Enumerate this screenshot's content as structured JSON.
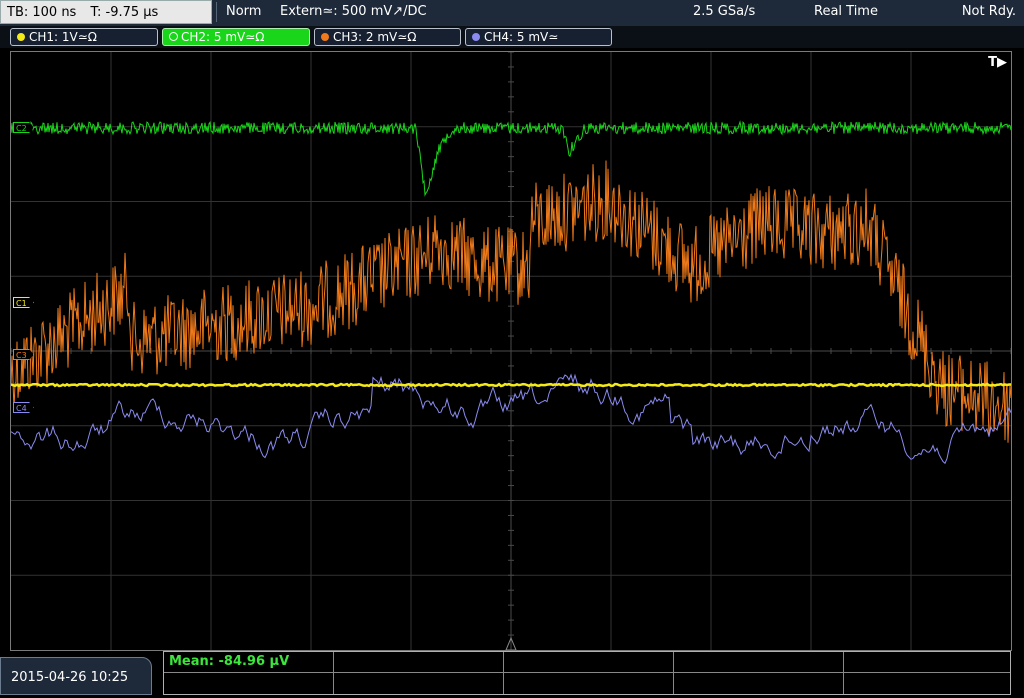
{
  "header": {
    "timebase": "TB: 100 ns",
    "trigger_time": "T: -9.75 µs",
    "mode": "Norm",
    "trigger_source": "Extern≃: 500 mV↗/DC",
    "sample_rate": "2.5 GSa/s",
    "acquisition": "Real Time",
    "status": "Not Rdy."
  },
  "channels": [
    {
      "label": "CH1: 1V≃Ω",
      "color": "#f4ea1a",
      "active": false
    },
    {
      "label": "CH2: 5 mV≃Ω",
      "color": "#1ad61a",
      "active": true
    },
    {
      "label": "CH3: 2 mV≃Ω",
      "color": "#f07a1a",
      "active": false
    },
    {
      "label": "CH4: 5 mV≃",
      "color": "#8a8af0",
      "active": false
    }
  ],
  "screen": {
    "trigger_marker": "T▶",
    "markers": [
      {
        "label": "C1",
        "color": "#f4ea1a"
      },
      {
        "label": "C3",
        "color": "#f07a1a"
      },
      {
        "label": "C4",
        "color": "#8a8af0"
      },
      {
        "label": "C2",
        "color": "#1ad61a"
      }
    ]
  },
  "footer": {
    "datetime": "2015-04-26 10:25",
    "measurement": "Mean: -84.96 µV"
  }
}
